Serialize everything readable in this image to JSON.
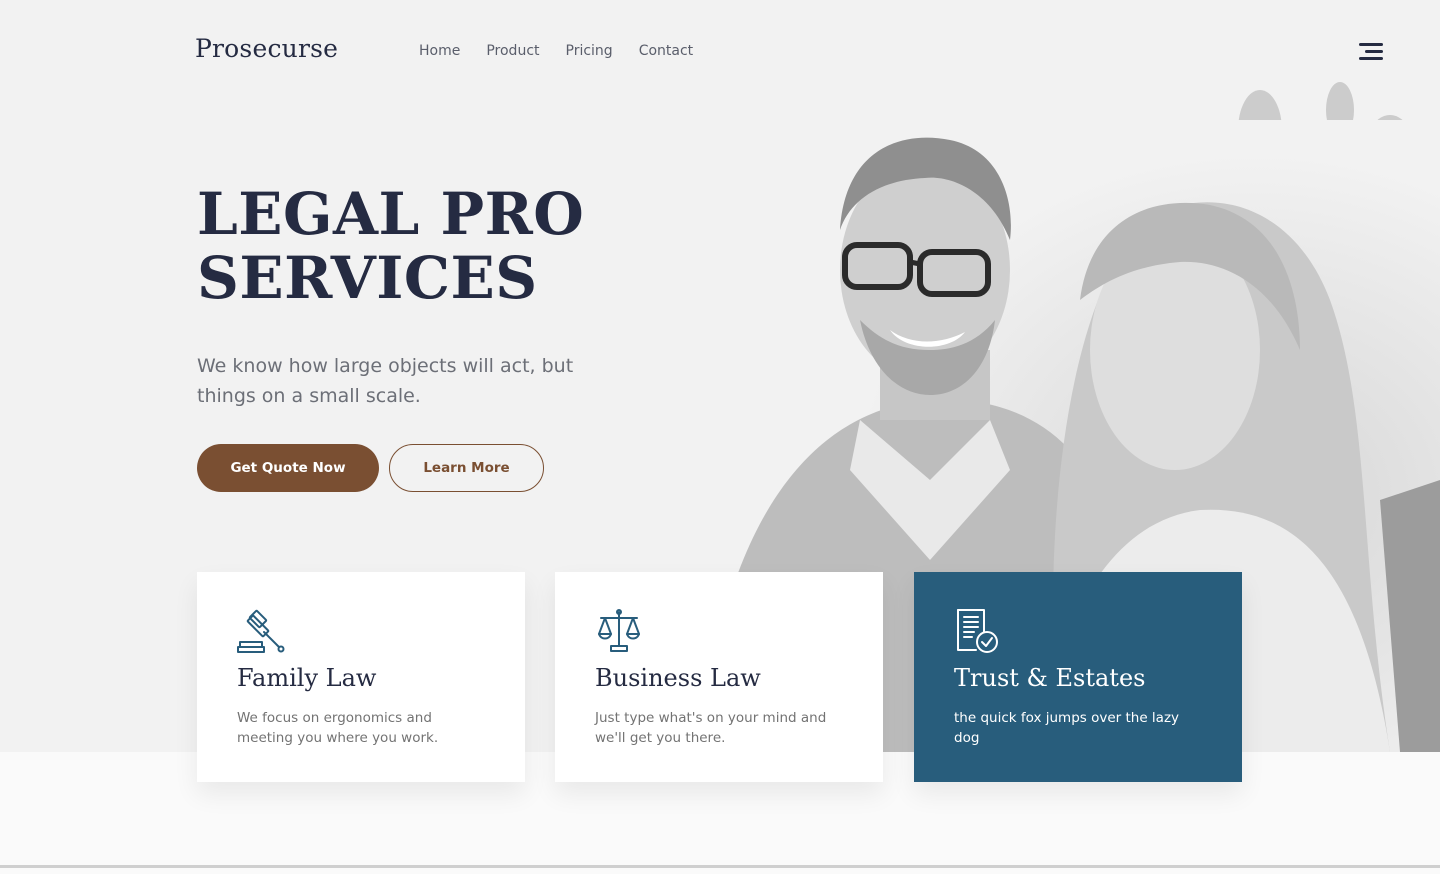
{
  "brand": "Prosecurse",
  "nav": {
    "items": [
      "Home",
      "Product",
      "Pricing",
      "Contact"
    ]
  },
  "menu_icon": "hamburger-menu-icon",
  "hero": {
    "title_line1": "LEGAL PRO",
    "title_line2": "SERVICES",
    "subtitle": "We know how large objects will act, but things on a small scale.",
    "primary_button": "Get Quote Now",
    "secondary_button": "Learn More",
    "image": "couple-portrait-grayscale"
  },
  "cards": [
    {
      "icon": "gavel-icon",
      "title": "Family Law",
      "description": "We focus on ergonomics and meeting you where you work."
    },
    {
      "icon": "scales-icon",
      "title": "Business Law",
      "description": "Just type what's on your mind and we'll get you there."
    },
    {
      "icon": "document-check-icon",
      "title": "Trust & Estates",
      "description": "the quick fox jumps over the lazy dog"
    }
  ],
  "colors": {
    "primary_text": "#252b42",
    "accent_brown": "#7a4f32",
    "accent_blue": "#285d7c",
    "hero_bg": "#f2f2f2",
    "muted_text": "#737373"
  }
}
